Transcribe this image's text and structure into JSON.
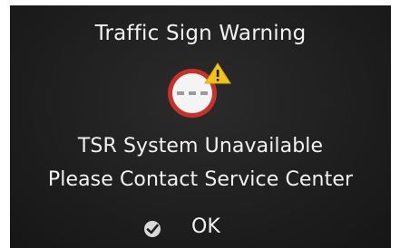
{
  "dialog": {
    "title": "Traffic Sign Warning",
    "icons": {
      "sign": "no-entry-sign-icon",
      "warning": "warning-triangle-icon",
      "ok": "checkmark-icon"
    },
    "message_line_1": "TSR System Unavailable",
    "message_line_2": "Please Contact Service Center",
    "ok_label": "OK"
  },
  "colors": {
    "background": "#1f1f1f",
    "text": "#f2f2f2",
    "sign_ring": "#c8302a",
    "sign_fill": "#f4f4f4",
    "sign_dash": "#9a9a9a",
    "warning": "#f3c417"
  }
}
